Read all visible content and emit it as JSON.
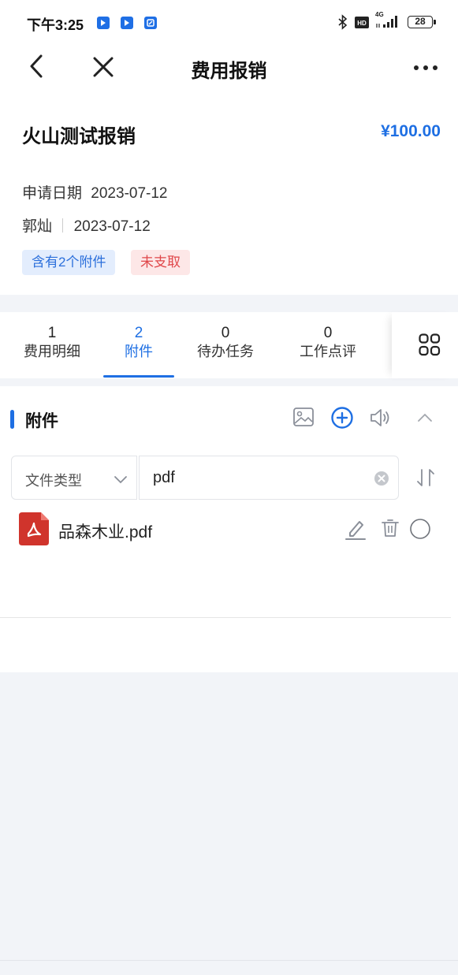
{
  "status_bar": {
    "time": "下午3:25",
    "battery": "28",
    "network": "4G"
  },
  "nav": {
    "title": "费用报销"
  },
  "record": {
    "title": "火山测试报销",
    "amount": "¥100.00",
    "apply_date_label": "申请日期",
    "apply_date": "2023-07-12",
    "applicant": "郭灿",
    "applicant_date": "2023-07-12",
    "tags": [
      {
        "label": "含有2个附件",
        "color": "#2b6fdb"
      },
      {
        "label": "未支取",
        "color": "#e0474a"
      }
    ]
  },
  "tabs": [
    {
      "count": "1",
      "label": "费用明细",
      "active": false
    },
    {
      "count": "2",
      "label": "附件",
      "active": true
    },
    {
      "count": "0",
      "label": "待办任务",
      "active": false
    },
    {
      "count": "0",
      "label": "工作点评",
      "active": false
    }
  ],
  "attachments": {
    "section_title": "附件",
    "filter_select_value": "文件类型",
    "search_value": "pdf",
    "files": [
      {
        "name": "品森木业.pdf",
        "icon": "pdf-file-icon"
      }
    ]
  },
  "colors": {
    "accent": "#1e6fe3",
    "tag_red": "#e0474a",
    "pdf_red": "#d0342c"
  }
}
